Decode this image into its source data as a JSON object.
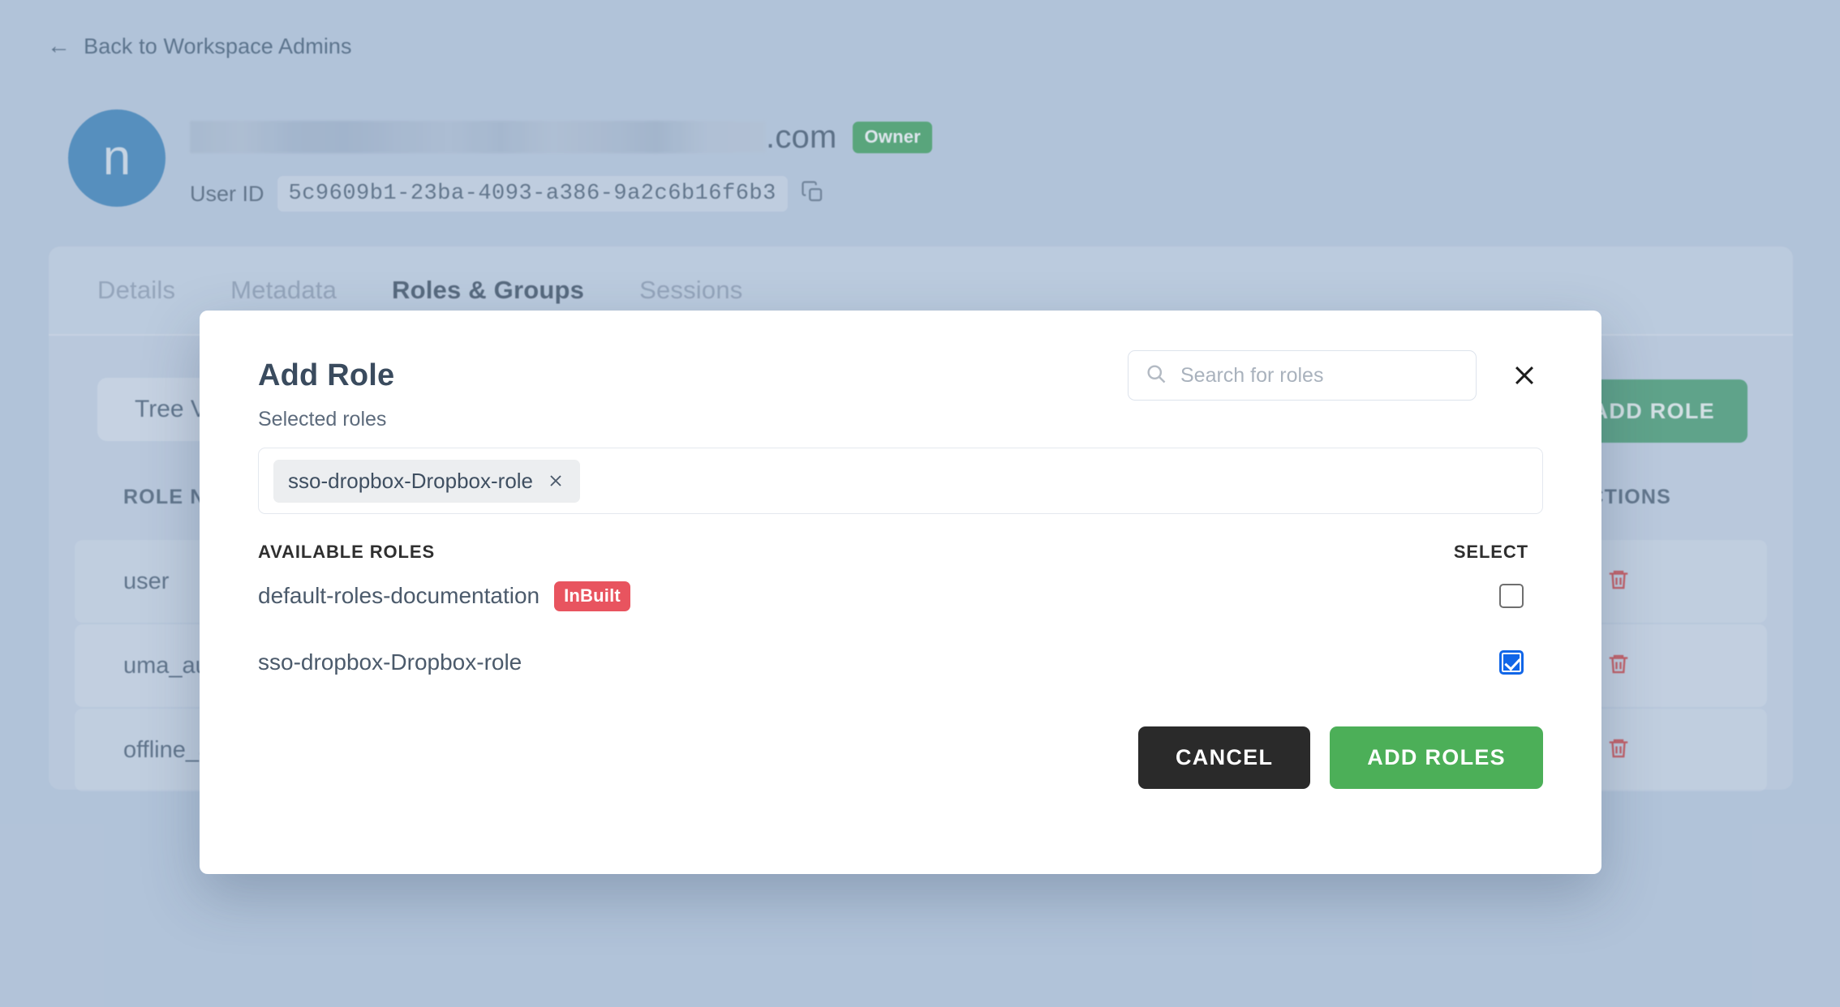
{
  "page": {
    "back_link": "Back to Workspace Admins",
    "back_arrow_icon": "arrow-left-icon"
  },
  "user": {
    "avatar_initial": "n",
    "email_domain_suffix": ".com",
    "email_redacted": true,
    "role_badge": "Owner",
    "user_id_label": "User ID",
    "user_id_value": "5c9609b1-23ba-4093-a386-9a2c6b16f6b3",
    "copy_icon": "copy-icon"
  },
  "tabs": [
    {
      "label": "Details",
      "active": false
    },
    {
      "label": "Metadata",
      "active": false
    },
    {
      "label": "Roles & Groups",
      "active": true
    },
    {
      "label": "Sessions",
      "active": false
    }
  ],
  "roles_panel": {
    "view_toggle_label": "Tree View",
    "add_role_button": "ADD ROLE",
    "add_role_icon": "plus-icon",
    "columns": {
      "role_name": "ROLE NAME",
      "actions": "ACTIONS"
    },
    "rows": [
      {
        "name": "user",
        "action_icon": "trash-icon"
      },
      {
        "name": "uma_authorization",
        "action_icon": "trash-icon"
      },
      {
        "name": "offline_access",
        "action_icon": "trash-icon"
      }
    ]
  },
  "modal": {
    "title": "Add Role",
    "search": {
      "placeholder": "Search for roles",
      "value": "",
      "icon": "search-icon"
    },
    "close_icon": "close-icon",
    "selected_roles_label": "Selected roles",
    "selected_roles": [
      {
        "label": "sso-dropbox-Dropbox-role",
        "remove_icon": "close-icon"
      }
    ],
    "available_header": "AVAILABLE ROLES",
    "select_header": "SELECT",
    "available_roles": [
      {
        "name": "default-roles-documentation",
        "badge": "InBuilt",
        "checked": false
      },
      {
        "name": "sso-dropbox-Dropbox-role",
        "badge": "",
        "checked": true
      }
    ],
    "cancel_button": "CANCEL",
    "confirm_button": "ADD ROLES"
  },
  "colors": {
    "page_background": "#b8c8de",
    "avatar": "#2a78b5",
    "owner_badge": "#2e9b4e",
    "add_role_green": "#379764",
    "confirm_green": "#4caf58",
    "cancel_dark": "#2a2a2a",
    "inbuilt_red": "#e8545f",
    "checkbox_blue": "#1166e8",
    "trash_red": "#d32f2f",
    "text_dark": "#3a4b5e"
  }
}
